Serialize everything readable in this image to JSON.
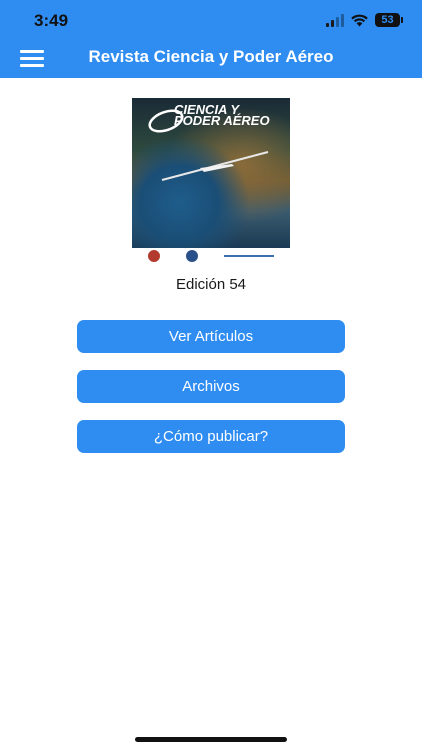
{
  "status_bar": {
    "time": "3:49",
    "battery": "53"
  },
  "app_bar": {
    "title": "Revista Ciencia y Poder Aéreo",
    "menu_icon": "hamburger-menu-icon"
  },
  "cover": {
    "brand_line1": "CIENCIA Y",
    "brand_line2": "PODER AÉREO",
    "edition": "Edición 54"
  },
  "buttons": {
    "articles": "Ver Artículos",
    "archives": "Archivos",
    "publish": "¿Cómo publicar?"
  },
  "colors": {
    "primary": "#2f8df2",
    "button_text": "#ffffff"
  }
}
